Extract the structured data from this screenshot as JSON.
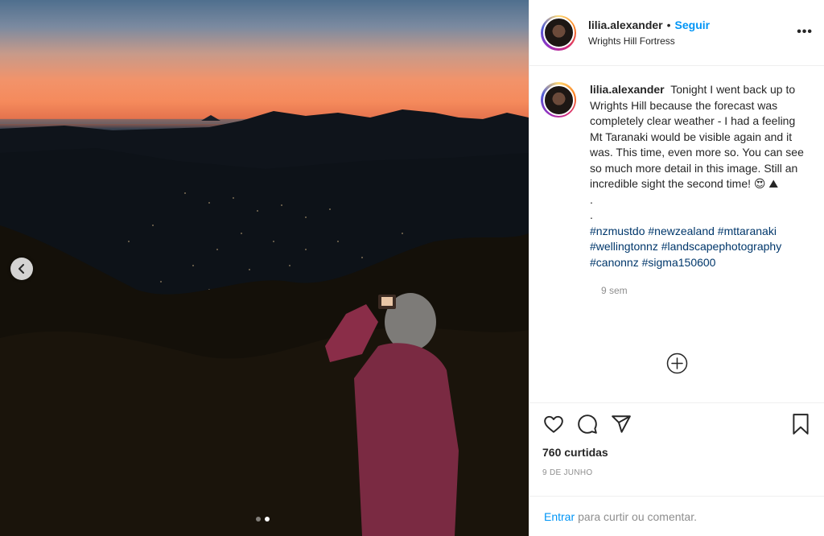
{
  "post": {
    "username": "lilia.alexander",
    "separator": "•",
    "follow_label": "Seguir",
    "location": "Wrights Hill Fortress",
    "more_label": "•••"
  },
  "caption": {
    "username": "lilia.alexander",
    "text": "Tonight I went back up to Wrights Hill because the forecast was completely clear weather - I had a feeling Mt Taranaki would be visible again and it was. This time, even more so. You can see so much more detail in this image. Still an incredible sight the second time! 😍 ⛰",
    "dot1": ".",
    "dot2": ".",
    "hashtags": [
      "#nzmustdo",
      "#newzealand",
      "#mttaranaki",
      "#wellingtonnz",
      "#landscapephotography",
      "#canonnz",
      "#sigma150600"
    ],
    "time": "9 sem"
  },
  "actions": {
    "likes": "760 curtidas",
    "date": "9 DE JUNHO"
  },
  "footer": {
    "login_label": "Entrar",
    "prompt": "para curtir ou comentar."
  },
  "carousel": {
    "current": 2,
    "total": 2
  },
  "icons": {
    "prev": "chevron-left-icon",
    "like": "heart-icon",
    "comment": "comment-bubble-icon",
    "share": "paper-plane-icon",
    "save": "bookmark-icon",
    "load_more": "plus-circle-icon"
  },
  "colors": {
    "link_blue": "#0095f6",
    "hashtag_blue": "#00376b",
    "muted": "#8e8e8e",
    "border": "#efefef"
  }
}
